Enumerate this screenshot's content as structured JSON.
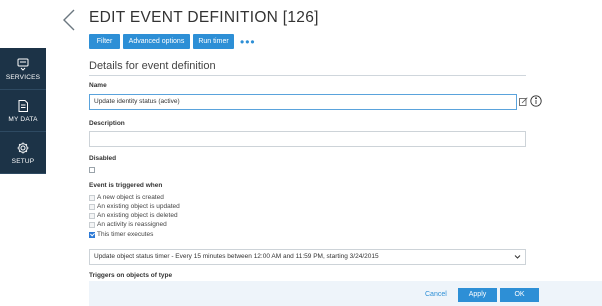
{
  "sidebar": {
    "items": [
      {
        "label": "SERVICES",
        "icon": "services-icon"
      },
      {
        "label": "MY DATA",
        "icon": "my-data-icon"
      },
      {
        "label": "SETUP",
        "icon": "gear-icon"
      }
    ]
  },
  "header": {
    "title": "EDIT EVENT DEFINITION [126]"
  },
  "toolbar": {
    "filter_label": "Filter",
    "advanced_label": "Advanced options",
    "run_timer_label": "Run timer",
    "more_label": "•••"
  },
  "form": {
    "section_title": "Details for event definition",
    "name_label": "Name",
    "name_value": "Update identity status (active)",
    "description_label": "Description",
    "description_value": "",
    "disabled_label": "Disabled",
    "disabled_checked": false,
    "trigger_label": "Event is triggered when",
    "trigger_options": [
      {
        "label": "A new object is created",
        "checked": false,
        "enabled": false
      },
      {
        "label": "An existing object is updated",
        "checked": false,
        "enabled": false
      },
      {
        "label": "An existing object is deleted",
        "checked": false,
        "enabled": false
      },
      {
        "label": "An activity is reassigned",
        "checked": false,
        "enabled": false
      },
      {
        "label": "This timer executes",
        "checked": true,
        "enabled": true
      }
    ],
    "timer_select_value": "Update object status timer - Every 15 minutes between 12:00 AM and 11:59 PM, starting 3/24/2015",
    "triggers_on_label": "Triggers on objects of type"
  },
  "footer": {
    "cancel_label": "Cancel",
    "apply_label": "Apply",
    "ok_label": "OK"
  },
  "colors": {
    "accent": "#2d8fd6",
    "sidebar_bg": "#1c3347",
    "footer_bg": "#eef4fa"
  }
}
